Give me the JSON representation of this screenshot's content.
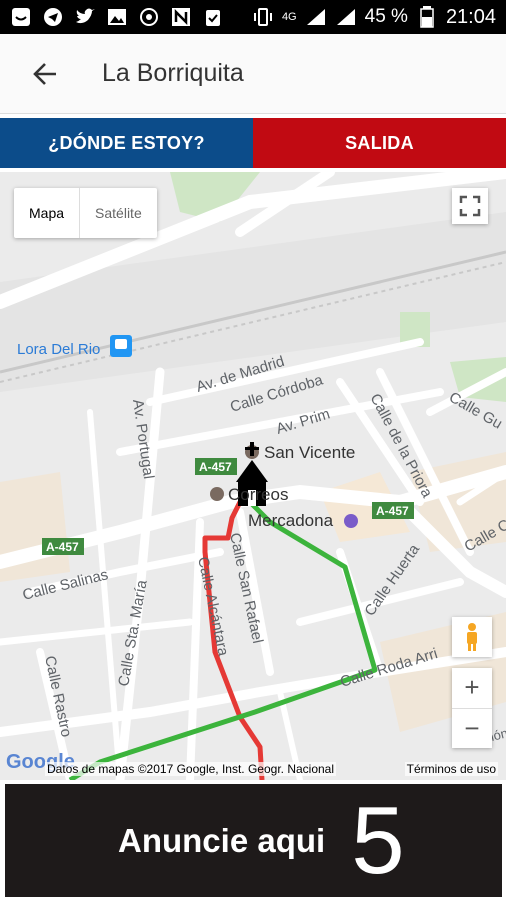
{
  "status_bar": {
    "battery": "45 %",
    "time": "21:04",
    "network": "4G"
  },
  "app_bar": {
    "title": "La Borriquita"
  },
  "buttons": {
    "where_am_i": "¿DÓNDE ESTOY?",
    "exit": "SALIDA"
  },
  "map": {
    "type_map": "Mapa",
    "type_satellite": "Satélite",
    "attribution": "Datos de mapas ©2017 Google, Inst. Geogr. Nacional",
    "terms": "Términos de uso",
    "logo": "Google",
    "labels": {
      "lora": "Lora Del Rio",
      "av_madrid": "Av. de Madrid",
      "calle_cordoba": "Calle Córdoba",
      "av_prim": "Av. Prim",
      "calle_priora": "Calle de la Priora",
      "calle_gu": "Calle Gu",
      "av_portugal": "Av. Portugal",
      "san_vicente": "San Vicente",
      "correos": "Correos",
      "mercadona": "Mercadona",
      "a457_1": "A-457",
      "a457_2": "A-457",
      "a457_3": "A-457",
      "calle_salinas": "Calle Salinas",
      "calle_sta_maria": "Calle Sta. María",
      "calle_alcantara": "Calle Alcántara",
      "calle_san_rafael": "Calle San Rafael",
      "calle_huerta": "Calle Huerta",
      "calle_roda": "Calle Roda Arri",
      "calle_rastro": "Calle Rastro",
      "calle_c": "Calle C",
      "calle_cajal": "Ramón y Cajal"
    },
    "zoom_in": "+",
    "zoom_out": "−"
  },
  "ad": {
    "text": "Anuncie aqui",
    "number": "5"
  },
  "colors": {
    "blue_button": "#0c4c8a",
    "red_button": "#c10a12",
    "route_red": "#e53935",
    "route_green": "#3cb43c"
  }
}
